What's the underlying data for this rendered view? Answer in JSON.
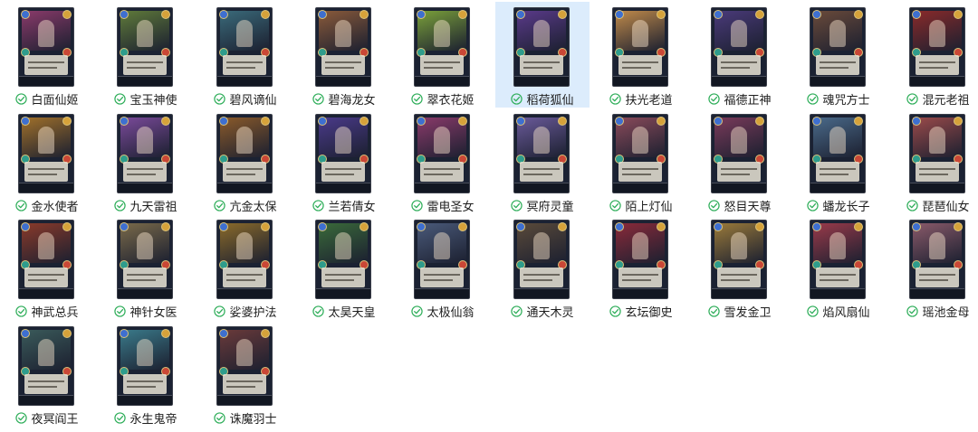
{
  "items": [
    {
      "name": "白面仙姬",
      "art": "#8a3a6a"
    },
    {
      "name": "宝玉神使",
      "art": "#5f7a3a"
    },
    {
      "name": "碧风谪仙",
      "art": "#3a6a7a"
    },
    {
      "name": "碧海龙女",
      "art": "#8a5a3a"
    },
    {
      "name": "翠衣花姬",
      "art": "#7aa03a"
    },
    {
      "name": "稻荷狐仙",
      "art": "#5a3a8a"
    },
    {
      "name": "扶光老道",
      "art": "#c08a4a"
    },
    {
      "name": "福德正神",
      "art": "#4a3a7a"
    },
    {
      "name": "魂咒方士",
      "art": "#6a4a3a"
    },
    {
      "name": "混元老祖",
      "art": "#8a2a2a"
    },
    {
      "name": "金水使者",
      "art": "#a0702a"
    },
    {
      "name": "九天雷祖",
      "art": "#7a4a9a"
    },
    {
      "name": "亢金太保",
      "art": "#8a5a2a"
    },
    {
      "name": "兰若倩女",
      "art": "#4a3a8a"
    },
    {
      "name": "雷电圣女",
      "art": "#8a3a6a"
    },
    {
      "name": "冥府灵童",
      "art": "#6a5a9a"
    },
    {
      "name": "陌上灯仙",
      "art": "#8a4a5a"
    },
    {
      "name": "怒目天尊",
      "art": "#7a3a5a"
    },
    {
      "name": "蟠龙长子",
      "art": "#4a6a8a"
    },
    {
      "name": "琵琶仙女",
      "art": "#9a4a4a"
    },
    {
      "name": "神武总兵",
      "art": "#8a3a2a"
    },
    {
      "name": "神针女医",
      "art": "#7a6a4a"
    },
    {
      "name": "娑婆护法",
      "art": "#8a6a2a"
    },
    {
      "name": "太昊天皇",
      "art": "#3a6a3a"
    },
    {
      "name": "太极仙翁",
      "art": "#4a5a7a"
    },
    {
      "name": "通天木灵",
      "art": "#5a4a3a"
    },
    {
      "name": "玄坛御史",
      "art": "#8a2a3a"
    },
    {
      "name": "雪发金卫",
      "art": "#9a7a3a"
    },
    {
      "name": "焰风扇仙",
      "art": "#9a3a4a"
    },
    {
      "name": "瑶池金母",
      "art": "#8a5a6a"
    },
    {
      "name": "夜冥阎王",
      "art": "#3a5a5a"
    },
    {
      "name": "永生鬼帝",
      "art": "#3a7a8a"
    },
    {
      "name": "诛魔羽士",
      "art": "#6a3a3a"
    }
  ],
  "selected_index": 5,
  "colors": {
    "selection": "#dcecfc",
    "check_green": "#2fae5a",
    "text": "#1e1e1e"
  },
  "icons": {
    "sync_status": "check-circle-icon"
  }
}
